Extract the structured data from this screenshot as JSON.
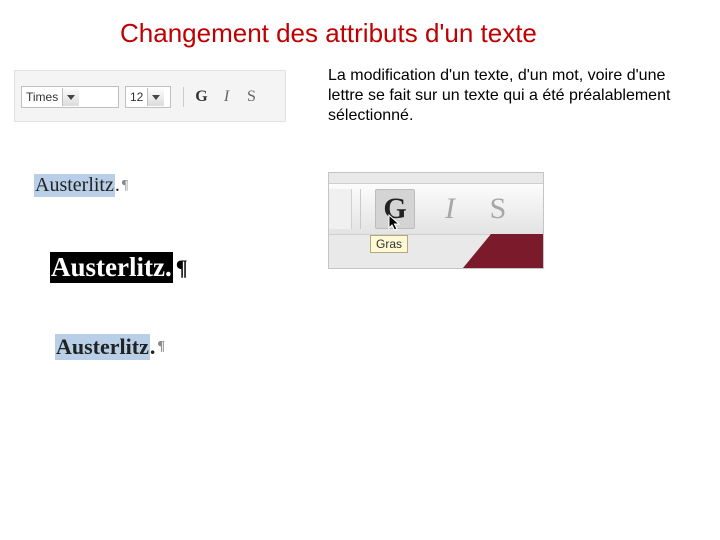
{
  "title": "Changement des attributs d'un texte",
  "paragraph": "La modification d'un texte, d'un mot, voire d'une lettre se fait sur un texte qui a été préalablement sélectionné.",
  "toolbar": {
    "font_name": "Times",
    "font_size": "12",
    "bold_glyph": "G",
    "italic_glyph": "I",
    "underline_glyph": "S"
  },
  "examples": {
    "word": "Austerlitz",
    "period": ".",
    "pilcrow": "¶"
  },
  "zoom_toolbar": {
    "bold_glyph": "G",
    "italic_glyph": "I",
    "underline_glyph": "S",
    "tooltip": "Gras"
  }
}
